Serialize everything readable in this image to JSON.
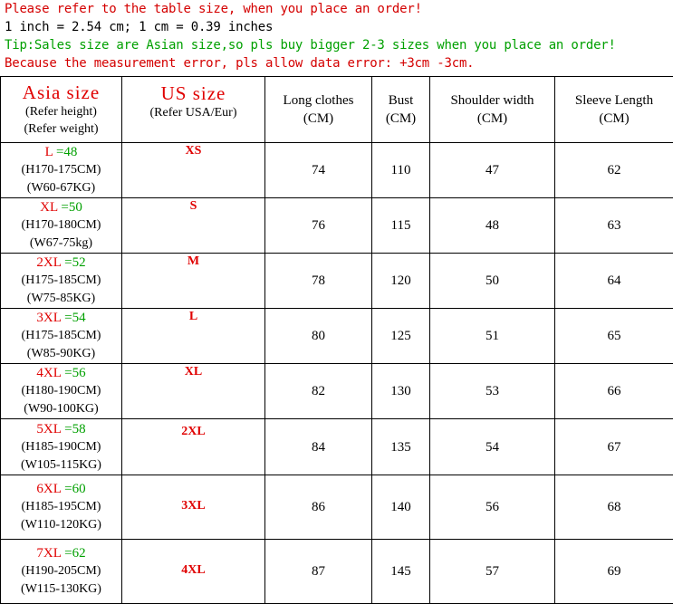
{
  "notes": [
    {
      "text": "Please refer to the table size, when you place an order!",
      "color": "red"
    },
    {
      "text": "1 inch = 2.54 cm; 1 cm = 0.39 inches",
      "color": "black"
    },
    {
      "text": "Tip:Sales size are Asian size,so pls buy bigger 2-3 sizes when you place an order!",
      "color": "green"
    },
    {
      "text": "Because the measurement error, pls allow data error: +3cm -3cm.",
      "color": "red"
    }
  ],
  "header": {
    "asia_title": "Asia size",
    "asia_sub1": "(Refer height)",
    "asia_sub2": "(Refer weight)",
    "us_title": "US size",
    "us_sub": "(Refer USA/Eur)",
    "length_title": "Long clothes",
    "length_unit": "(CM)",
    "bust_title": "Bust",
    "bust_unit": "(CM)",
    "shoulder_title": "Shoulder width",
    "shoulder_unit": "(CM)",
    "sleeve_title": "Sleeve Length",
    "sleeve_unit": "(CM)"
  },
  "rows": [
    {
      "asia_label": "L",
      "asia_num": " =48",
      "height": "(H170-175CM)",
      "weight": "(W60-67KG)",
      "us": "XS",
      "length": "74",
      "bust": "110",
      "shoulder": "47",
      "sleeve": "62"
    },
    {
      "asia_label": "XL",
      "asia_num": " =50",
      "height": "(H170-180CM)",
      "weight": "(W67-75kg)",
      "us": "S",
      "length": "76",
      "bust": "115",
      "shoulder": "48",
      "sleeve": "63"
    },
    {
      "asia_label": "2XL",
      "asia_num": " =52",
      "height": "(H175-185CM)",
      "weight": "(W75-85KG)",
      "us": "M",
      "length": "78",
      "bust": "120",
      "shoulder": "50",
      "sleeve": "64"
    },
    {
      "asia_label": "3XL",
      "asia_num": " =54",
      "height": "(H175-185CM)",
      "weight": "(W85-90KG)",
      "us": "L",
      "length": "80",
      "bust": "125",
      "shoulder": "51",
      "sleeve": "65"
    },
    {
      "asia_label": "4XL",
      "asia_num": " =56",
      "height": "(H180-190CM)",
      "weight": "(W90-100KG)",
      "us": "XL",
      "length": "82",
      "bust": "130",
      "shoulder": "53",
      "sleeve": "66"
    },
    {
      "asia_label": "5XL",
      "asia_num": " =58",
      "height": "(H185-190CM)",
      "weight": "(W105-115KG)",
      "us": "2XL",
      "length": "84",
      "bust": "135",
      "shoulder": "54",
      "sleeve": "67"
    },
    {
      "asia_label": "6XL",
      "asia_num": " =60",
      "height": "(H185-195CM)",
      "weight": "(W110-120KG)",
      "us": "3XL",
      "length": "86",
      "bust": "140",
      "shoulder": "56",
      "sleeve": "68"
    },
    {
      "asia_label": "7XL",
      "asia_num": " =62",
      "height": "(H190-205CM)",
      "weight": "(W115-130KG)",
      "us": "4XL",
      "length": "87",
      "bust": "145",
      "shoulder": "57",
      "sleeve": "69"
    }
  ]
}
